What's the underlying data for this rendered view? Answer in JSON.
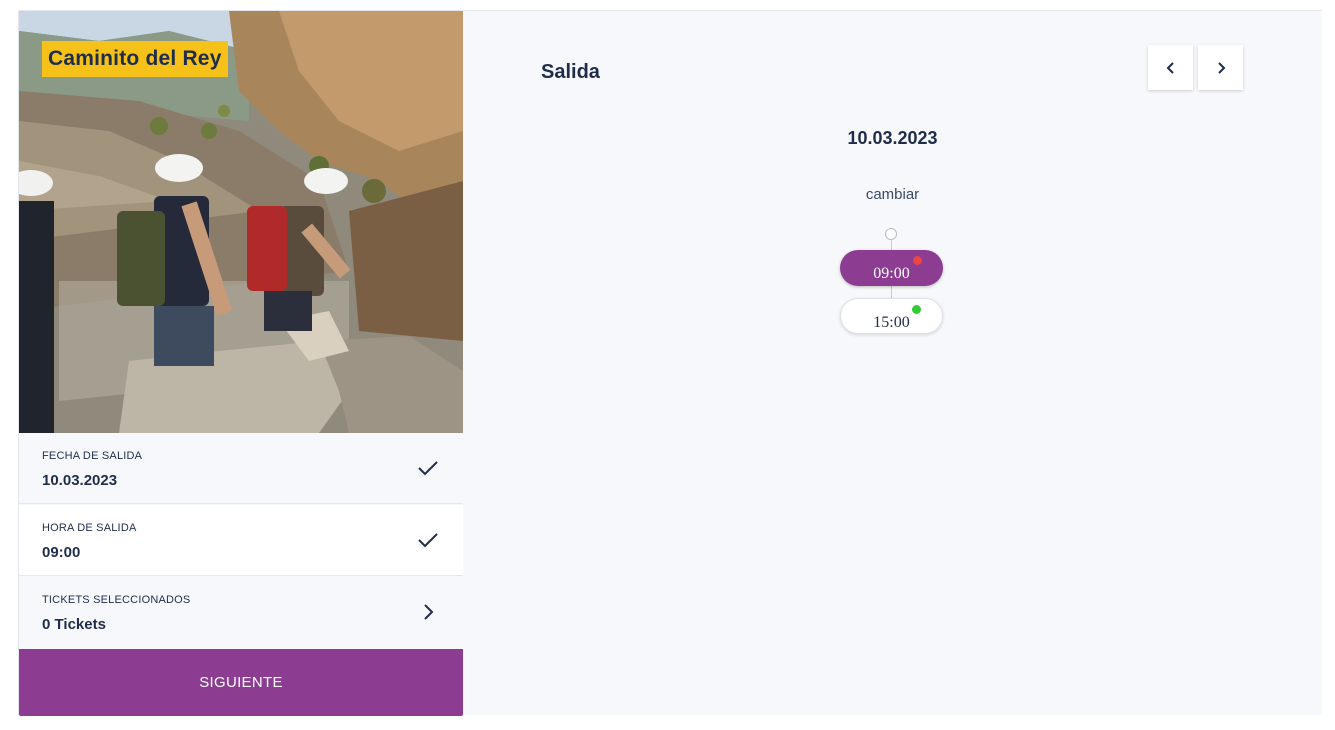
{
  "tour": {
    "title": "Caminito del Rey"
  },
  "summary": {
    "departure_date": {
      "label": "FECHA DE SALIDA",
      "value": "10.03.2023",
      "icon": "check-icon"
    },
    "departure_time": {
      "label": "HORA DE SALIDA",
      "value": "09:00",
      "icon": "check-icon"
    },
    "tickets": {
      "label": "TICKETS SELECCIONADOS",
      "value": "0 Tickets",
      "icon": "chevron-right-icon"
    }
  },
  "actions": {
    "next_label": "SIGUIENTE"
  },
  "panel": {
    "title": "Salida",
    "selected_date": "10.03.2023",
    "change_label": "cambiar",
    "prev_icon": "chevron-left-icon",
    "next_icon": "chevron-right-icon"
  },
  "time_slots": [
    {
      "time": "09:00",
      "selected": true,
      "status_color": "#ee4444"
    },
    {
      "time": "15:00",
      "selected": false,
      "status_color": "#33cc33"
    }
  ],
  "colors": {
    "accent": "#8c3d91",
    "title_badge": "#f6c21a",
    "text": "#1f2d4a"
  }
}
